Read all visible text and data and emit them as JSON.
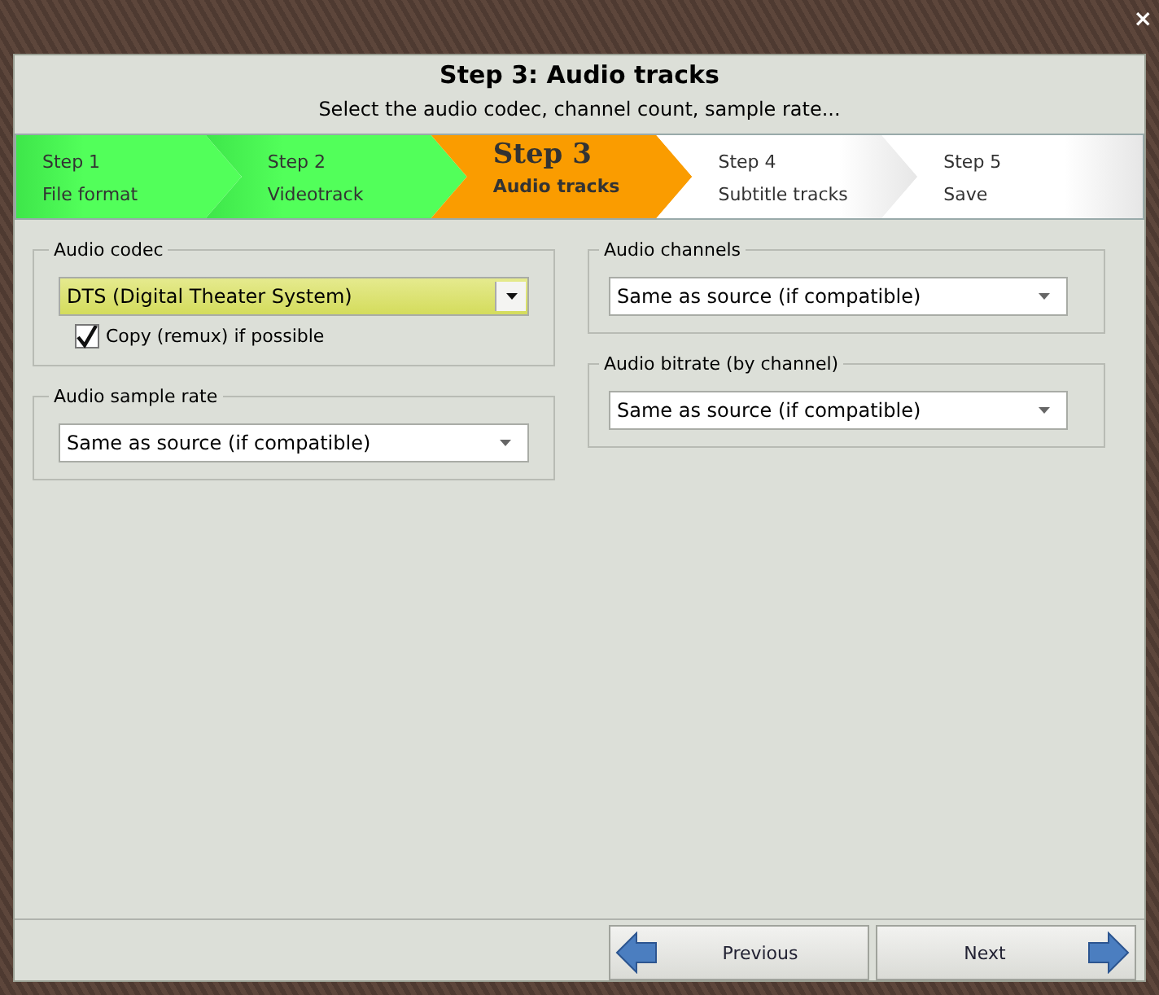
{
  "window": {
    "close": "×"
  },
  "header": {
    "title": "Step 3: Audio tracks",
    "subtitle": "Select the audio codec, channel count, sample rate..."
  },
  "steps": [
    {
      "number": "Step 1",
      "label": "File format",
      "selected": false,
      "completed": true
    },
    {
      "number": "Step 2",
      "label": "Videotrack",
      "selected": false,
      "completed": true
    },
    {
      "number": "Step 3",
      "label": "Audio tracks",
      "selected": true,
      "completed": false
    },
    {
      "number": "Step 4",
      "label": "Subtitle tracks",
      "selected": false,
      "completed": false
    },
    {
      "number": "Step 5",
      "label": "Save",
      "selected": false,
      "completed": false
    }
  ],
  "left_groups": [
    {
      "title": "Audio codec",
      "dropdown": {
        "value": "DTS (Digital Theater System)",
        "highlighted": true
      },
      "checkbox": {
        "label": "Copy (remux) if possible",
        "checked": true
      }
    },
    {
      "title": "Audio sample rate",
      "dropdown": {
        "value": "Same as source (if compatible)",
        "highlighted": false
      }
    }
  ],
  "right_groups": [
    {
      "title": "Audio channels",
      "dropdown": {
        "value": "Same as source (if compatible)",
        "highlighted": false
      }
    },
    {
      "title": "Audio bitrate (by channel)",
      "dropdown": {
        "value": "Same as source (if compatible)",
        "highlighted": false
      }
    }
  ],
  "buttons": [
    {
      "label": "Previous",
      "kind": "back"
    },
    {
      "label": "Next",
      "kind": "forward"
    }
  ]
}
